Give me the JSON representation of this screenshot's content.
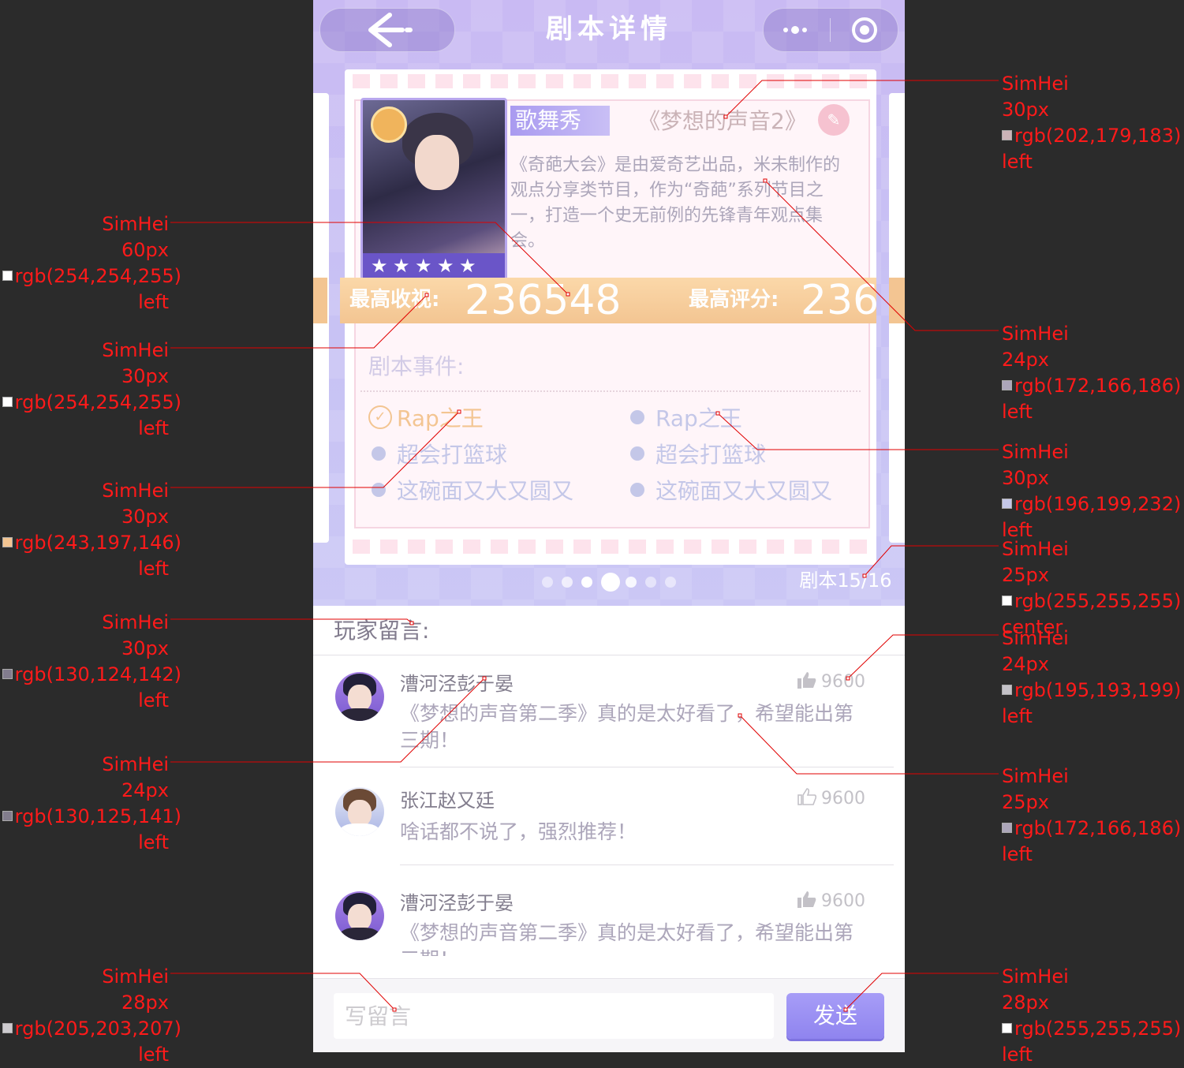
{
  "header": {
    "title": "剧本详情",
    "back_icon": "arrow-left-icon",
    "more_icon": "more-dots-icon",
    "close_icon": "target-circle-icon"
  },
  "script_card": {
    "tag": "歌舞秀",
    "show_title": "《梦想的声音2》",
    "description": "《奇葩大会》是由爱奇艺出品，米未制作的观点分享类节目，作为“奇葩”系列节目之一，打造一个史无前例的先锋青年观点集会。",
    "rating_stars": 5,
    "stats": {
      "max_view_label": "最高收视:",
      "max_view_value": "236548",
      "max_score_label": "最高评分:",
      "max_score_value": "236"
    },
    "events_title": "剧本事件:",
    "events": [
      {
        "label": "Rap之王",
        "done": true
      },
      {
        "label": "Rap之王",
        "done": false
      },
      {
        "label": "超会打篮球",
        "done": false
      },
      {
        "label": "超会打篮球",
        "done": false
      },
      {
        "label": "这碗面又大又圆又",
        "done": false
      },
      {
        "label": "这碗面又大又圆又",
        "done": false
      }
    ],
    "counter": "剧本15/16",
    "page_dots": 7,
    "active_dot": 3
  },
  "comments": {
    "title": "玩家留言:",
    "items": [
      {
        "name": "漕河泾彭于晏",
        "text": "《梦想的声音第二季》真的是太好看了，希望能出第三期！",
        "likes": "9600",
        "liked": true
      },
      {
        "name": "张江赵又廷",
        "text": "啥话都不说了，强烈推荐！",
        "likes": "9600",
        "liked": false
      },
      {
        "name": "漕河泾彭于晏",
        "text": "《梦想的声音第二季》真的是太好看了，希望能出第三期！",
        "likes": "9600",
        "liked": true
      }
    ]
  },
  "input_bar": {
    "placeholder": "写留言",
    "send_label": "发送"
  },
  "annotations": {
    "a1": {
      "font": "SimHei",
      "size": "30px",
      "color": "rgb(202,179,183)",
      "align": "left",
      "swatch": "#cab3b7"
    },
    "a2": {
      "font": "SimHei",
      "size": "60px",
      "color": "rgb(254,254,255)",
      "align": "left",
      "swatch": "#fefeff"
    },
    "a3": {
      "font": "SimHei",
      "size": "24px",
      "color": "rgb(172,166,186)",
      "align": "left",
      "swatch": "#aca6ba"
    },
    "a4": {
      "font": "SimHei",
      "size": "30px",
      "color": "rgb(254,254,255)",
      "align": "left",
      "swatch": "#fefeff"
    },
    "a5": {
      "font": "SimHei",
      "size": "30px",
      "color": "rgb(196,199,232)",
      "align": "left",
      "swatch": "#c4c7e8"
    },
    "a6": {
      "font": "SimHei",
      "size": "30px",
      "color": "rgb(243,197,146)",
      "align": "left",
      "swatch": "#f3c592"
    },
    "a7": {
      "font": "SimHei",
      "size": "25px",
      "color": "rgb(255,255,255)",
      "align": "center",
      "swatch": "#ffffff"
    },
    "a8": {
      "font": "SimHei",
      "size": "30px",
      "color": "rgb(130,124,142)",
      "align": "left",
      "swatch": "#827c8e"
    },
    "a9": {
      "font": "SimHei",
      "size": "24px",
      "color": "rgb(195,193,199)",
      "align": "left",
      "swatch": "#c3c1c7"
    },
    "a10": {
      "font": "SimHei",
      "size": "24px",
      "color": "rgb(130,125,141)",
      "align": "left",
      "swatch": "#827d8d"
    },
    "a11": {
      "font": "SimHei",
      "size": "25px",
      "color": "rgb(172,166,186)",
      "align": "left",
      "swatch": "#aca6ba"
    },
    "a12": {
      "font": "SimHei",
      "size": "28px",
      "color": "rgb(205,203,207)",
      "align": "left",
      "swatch": "#cdcbcf"
    },
    "a13": {
      "font": "SimHei",
      "size": "28px",
      "color": "rgb(255,255,255)",
      "align": "left",
      "swatch": "#ffffff"
    }
  }
}
